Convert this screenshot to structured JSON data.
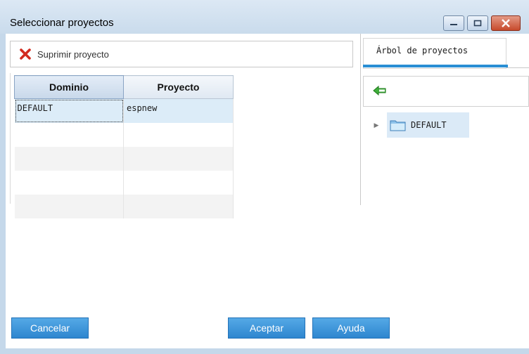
{
  "window": {
    "title": "Seleccionar proyectos",
    "controls": [
      "minimize-icon",
      "maximize-icon",
      "close-icon"
    ],
    "accent": "#2a8fd4"
  },
  "toolbar": {
    "delete_label": "Suprimir proyecto",
    "delete_icon": "red-x-icon"
  },
  "grid": {
    "headers": [
      "Dominio",
      "Proyecto"
    ],
    "rows": [
      [
        "DEFAULT",
        "espnew"
      ],
      [
        "",
        ""
      ],
      [
        "",
        ""
      ],
      [
        "",
        ""
      ],
      [
        "",
        ""
      ]
    ]
  },
  "tree_panel": {
    "tab_label": "Árbol de proyectos",
    "back_icon": "green-arrow-left-icon",
    "nodes": [
      {
        "label": "DEFAULT",
        "icon": "folder-icon",
        "expanded": false
      }
    ]
  },
  "buttons": {
    "cancel": "Cancelar",
    "accept": "Aceptar",
    "help": "Ayuda"
  }
}
